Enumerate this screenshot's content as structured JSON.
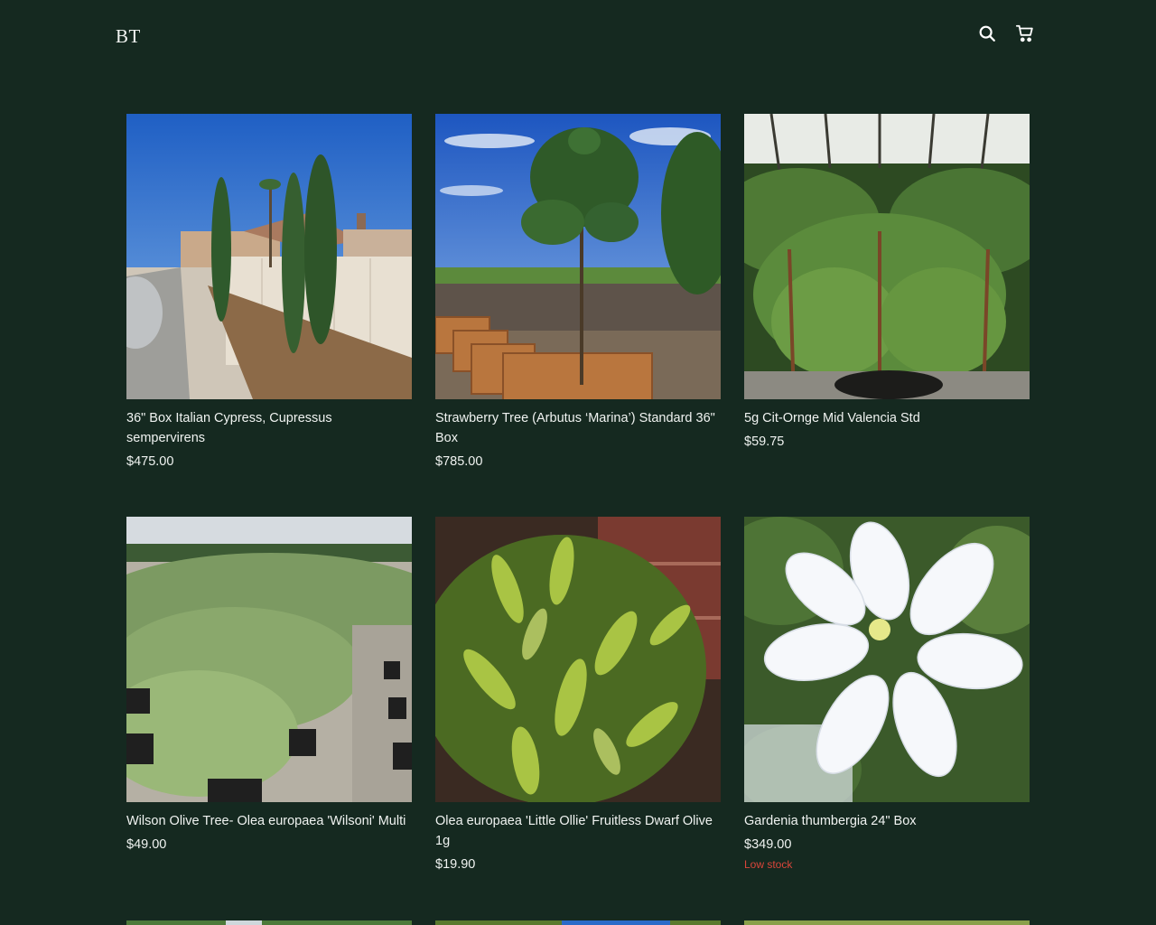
{
  "header": {
    "logo": "BT",
    "icons": [
      "search-icon",
      "cart-icon"
    ]
  },
  "products": [
    {
      "title": "36\" Box Italian Cypress, Cupressus sempervirens",
      "price": "$475.00",
      "badge": ""
    },
    {
      "title": "Strawberry Tree (Arbutus ‘Marina’) Standard 36\" Box",
      "price": "$785.00",
      "badge": ""
    },
    {
      "title": "5g Cit-Ornge Mid Valencia Std",
      "price": "$59.75",
      "badge": ""
    },
    {
      "title": "Wilson Olive Tree- Olea europaea 'Wilsoni' Multi",
      "price": "$49.00",
      "badge": ""
    },
    {
      "title": "Olea europaea 'Little Ollie' Fruitless Dwarf Olive 1g",
      "price": "$19.90",
      "badge": ""
    },
    {
      "title": "Gardenia thumbergia 24\" Box",
      "price": "$349.00",
      "badge": "Low stock"
    }
  ],
  "colors": {
    "background": "#152920",
    "text": "#f0f3f1",
    "low_stock": "#d9453a"
  }
}
